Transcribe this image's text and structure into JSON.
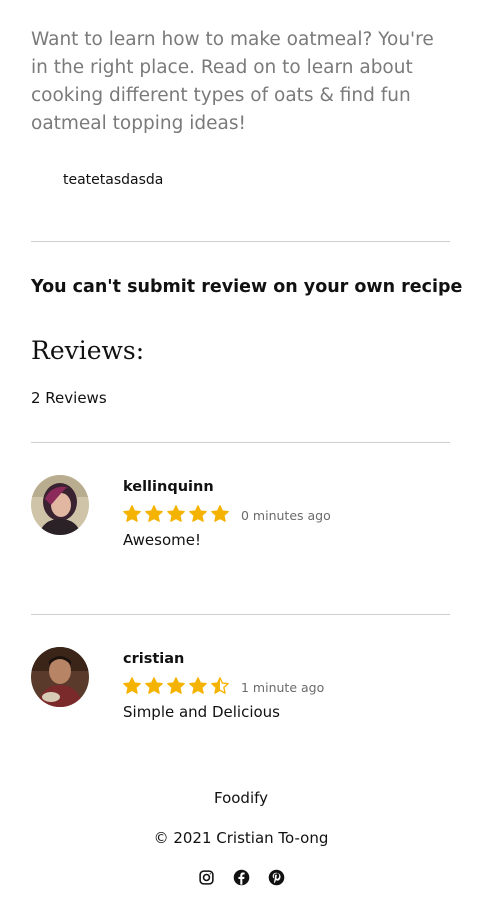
{
  "recipe": {
    "intro": "Want to learn how to make oatmeal? You're in the right place. Read on to learn about cooking different types of oats & find fun oatmeal topping ideas!",
    "extra_text": "teatetasdasda"
  },
  "notice": "You can't submit review on your own recipe",
  "reviews": {
    "heading": "Reviews:",
    "count_label": "2 Reviews",
    "star_color": "#f5b301",
    "items": [
      {
        "name": "kellinquinn",
        "rating": 5,
        "time": "0 minutes ago",
        "text": "Awesome!"
      },
      {
        "name": "cristian",
        "rating": 4.5,
        "time": "1 minute ago",
        "text": "Simple and Delicious"
      }
    ]
  },
  "footer": {
    "brand": "Foodify",
    "copyright": "© 2021 Cristian To-ong",
    "social": [
      "instagram-icon",
      "facebook-icon",
      "pinterest-icon"
    ]
  }
}
